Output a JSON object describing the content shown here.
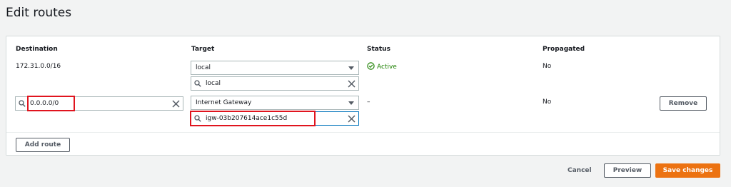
{
  "page": {
    "title": "Edit routes"
  },
  "columns": {
    "destination": "Destination",
    "target": "Target",
    "status": "Status",
    "propagated": "Propagated"
  },
  "routes": [
    {
      "destination": "172.31.0.0/16",
      "target_select": "local",
      "target_search": "local",
      "status": "Active",
      "propagated": "No"
    },
    {
      "destination_search": "0.0.0.0/0",
      "target_select": "Internet Gateway",
      "target_search": "igw-03b207614ace1c55d",
      "status": "–",
      "propagated": "No",
      "remove_label": "Remove"
    }
  ],
  "actions": {
    "add_route": "Add route",
    "cancel": "Cancel",
    "preview": "Preview",
    "save": "Save changes"
  },
  "colors": {
    "accent": "#ec7211",
    "highlight": "#e0141e",
    "active_status": "#1d8102",
    "focus": "#0073bb"
  },
  "icons": [
    "search-icon",
    "clear-icon",
    "dropdown-caret-icon",
    "check-circle-icon"
  ]
}
